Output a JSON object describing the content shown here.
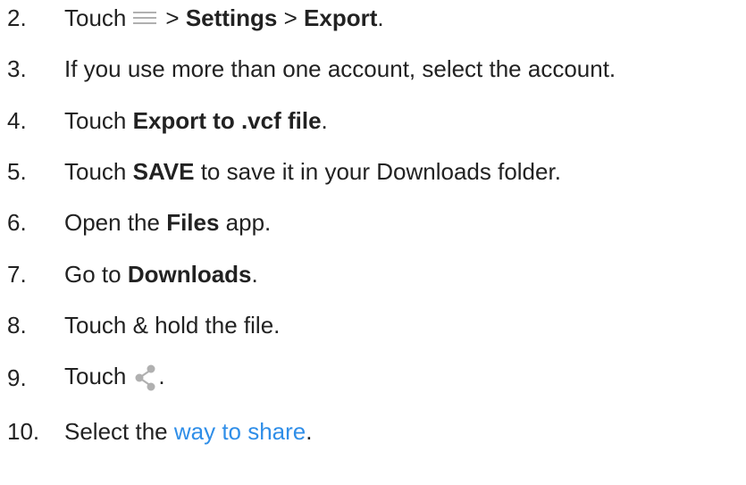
{
  "steps": [
    {
      "num": "2.",
      "prefix": "Touch",
      "sep1": ">",
      "b1": "Settings",
      "sep2": ">",
      "b2": "Export",
      "suffix": "."
    },
    {
      "num": "3.",
      "text": "If you use more than one account, select the account."
    },
    {
      "num": "4.",
      "prefix": "Touch ",
      "bold": "Export to .vcf file",
      "suffix": "."
    },
    {
      "num": "5.",
      "prefix": "Touch ",
      "bold": "SAVE",
      "suffix": " to save it in your Downloads folder."
    },
    {
      "num": "6.",
      "prefix": "Open the ",
      "bold": "Files",
      "suffix": " app."
    },
    {
      "num": "7.",
      "prefix": "Go to ",
      "bold": "Downloads",
      "suffix": "."
    },
    {
      "num": "8.",
      "text": "Touch & hold the file."
    },
    {
      "num": "9.",
      "prefix": "Touch",
      "suffix": "."
    },
    {
      "num": "10.",
      "prefix": "Select the ",
      "link": "way to share",
      "suffix": "."
    }
  ],
  "icons": {
    "menu": "menu-icon",
    "share": "share-icon"
  },
  "colors": {
    "text": "#222222",
    "link": "#2f8ee8",
    "icon": "#b0b0b0"
  }
}
